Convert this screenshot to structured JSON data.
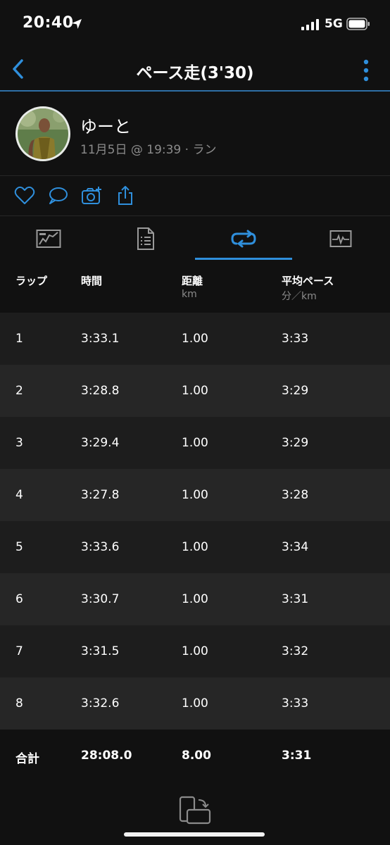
{
  "status_bar": {
    "time": "20:40",
    "network": "5G"
  },
  "nav": {
    "title": "ペース走(3'30)"
  },
  "profile": {
    "name": "ゆーと",
    "meta": "11月5日 @ 19:39 · ラン"
  },
  "tabs": [
    {
      "icon": "chart-overview-icon"
    },
    {
      "icon": "stats-list-icon"
    },
    {
      "icon": "laps-loop-icon",
      "selected": true
    },
    {
      "icon": "activity-graph-icon"
    }
  ],
  "table": {
    "headers": {
      "lap": "ラップ",
      "time": "時間",
      "distance": "距離",
      "distance_unit": "km",
      "pace": "平均ペース",
      "pace_unit": "分／km"
    },
    "rows": [
      {
        "lap": "1",
        "time": "3:33.1",
        "distance": "1.00",
        "pace": "3:33"
      },
      {
        "lap": "2",
        "time": "3:28.8",
        "distance": "1.00",
        "pace": "3:29"
      },
      {
        "lap": "3",
        "time": "3:29.4",
        "distance": "1.00",
        "pace": "3:29"
      },
      {
        "lap": "4",
        "time": "3:27.8",
        "distance": "1.00",
        "pace": "3:28"
      },
      {
        "lap": "5",
        "time": "3:33.6",
        "distance": "1.00",
        "pace": "3:34"
      },
      {
        "lap": "6",
        "time": "3:30.7",
        "distance": "1.00",
        "pace": "3:31"
      },
      {
        "lap": "7",
        "time": "3:31.5",
        "distance": "1.00",
        "pace": "3:32"
      },
      {
        "lap": "8",
        "time": "3:32.6",
        "distance": "1.00",
        "pace": "3:33"
      }
    ],
    "total": {
      "label": "合計",
      "time": "28:08.0",
      "distance": "8.00",
      "pace": "3:31"
    }
  },
  "colors": {
    "accent": "#2f8fdc",
    "background": "#111111",
    "row_odd": "#1d1d1d",
    "row_even": "#262626",
    "muted": "#8b8b8b"
  }
}
